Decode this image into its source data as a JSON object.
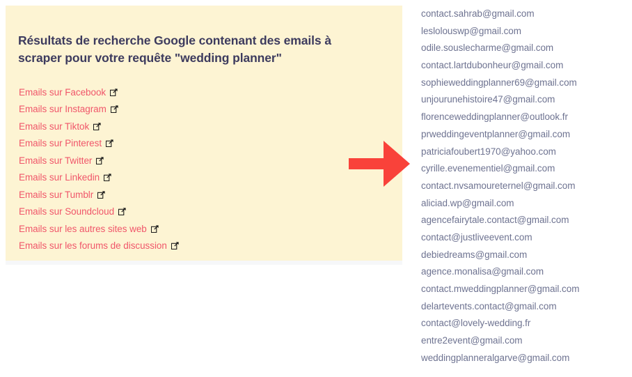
{
  "panel": {
    "title": "Résultats de recherche Google contenant des emails à scraper pour votre requête \"wedding planner\"",
    "links": [
      {
        "label": "Emails sur Facebook",
        "icon": "external-link-icon"
      },
      {
        "label": "Emails sur Instagram",
        "icon": "external-link-icon"
      },
      {
        "label": "Emails sur Tiktok",
        "icon": "external-link-icon"
      },
      {
        "label": "Emails sur Pinterest",
        "icon": "external-link-icon"
      },
      {
        "label": "Emails sur Twitter",
        "icon": "external-link-icon"
      },
      {
        "label": "Emails sur Linkedin",
        "icon": "external-link-icon"
      },
      {
        "label": "Emails sur Tumblr",
        "icon": "external-link-icon"
      },
      {
        "label": "Emails sur Soundcloud",
        "icon": "external-link-icon"
      },
      {
        "label": "Emails sur les autres sites web",
        "icon": "external-link-icon"
      },
      {
        "label": "Emails sur les forums de discussion",
        "icon": "external-link-icon"
      }
    ]
  },
  "arrow": {
    "icon": "right-arrow-icon",
    "color": "#f9423a"
  },
  "emails": [
    "contact.sahrab@gmail.com",
    "leslolouswp@gmail.com",
    "odile.souslecharme@gmail.com",
    "contact.lartdubonheur@gmail.com",
    "sophieweddingplanner69@gmail.com",
    "unjourunehistoire47@gmail.com",
    "florenceweddingplanner@outlook.fr",
    "prweddingeventplanner@gmail.com",
    "patriciafoubert1970@yahoo.com",
    "cyrille.evenementiel@gmail.com",
    "contact.nvsamoureternel@gmail.com",
    "aliciad.wp@gmail.com",
    "agencefairytale.contact@gmail.com",
    "contact@justliveevent.com",
    "debiedreams@gmail.com",
    "agence.monalisa@gmail.com",
    "contact.mweddingplanner@gmail.com",
    "delartevents.contact@gmail.com",
    "contact@lovely-wedding.fr",
    "entre2event@gmail.com",
    "weddingplanneralgarve@gmail.com"
  ],
  "colors": {
    "panel_background": "#fdf4d3",
    "title_text": "#3d3b5e",
    "link_text": "#f0566a",
    "email_text": "#6e7391",
    "arrow": "#f9423a",
    "page_background": "#ffffff"
  }
}
